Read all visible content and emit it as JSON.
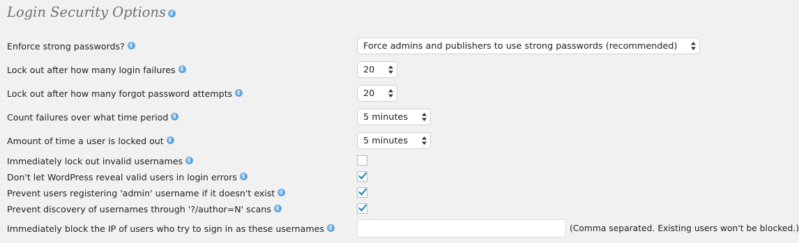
{
  "section": {
    "title": "Login Security Options"
  },
  "settings": {
    "strong_passwords": {
      "label": "Enforce strong passwords?",
      "value": "Force admins and publishers to use strong passwords (recommended)"
    },
    "login_failures": {
      "label": "Lock out after how many login failures",
      "value": "20"
    },
    "forgot_password_attempts": {
      "label": "Lock out after how many forgot password attempts",
      "value": "20"
    },
    "failure_period": {
      "label": "Count failures over what time period",
      "value": "5 minutes"
    },
    "lockout_time": {
      "label": "Amount of time a user is locked out",
      "value": "5 minutes"
    },
    "lock_invalid_usernames": {
      "label": "Immediately lock out invalid usernames",
      "checked": false
    },
    "hide_valid_users": {
      "label": "Don't let WordPress reveal valid users in login errors",
      "checked": true
    },
    "prevent_admin_username": {
      "label": "Prevent users registering 'admin' username if it doesn't exist",
      "checked": true
    },
    "prevent_author_scans": {
      "label": "Prevent discovery of usernames through '?/author=N' scans",
      "checked": true
    },
    "block_usernames": {
      "label": "Immediately block the IP of users who try to sign in as these usernames",
      "value": "",
      "hint": "(Comma separated. Existing users won't be blocked.)"
    }
  },
  "icons": {
    "info": "info-icon",
    "select_arrows": "up-down-arrows-icon",
    "check": "checkmark-icon"
  },
  "colors": {
    "background": "#f1f1f1",
    "title": "#6f6f6f",
    "info_icon": "#5fa6e3",
    "checkmark": "#1e8cbe"
  }
}
